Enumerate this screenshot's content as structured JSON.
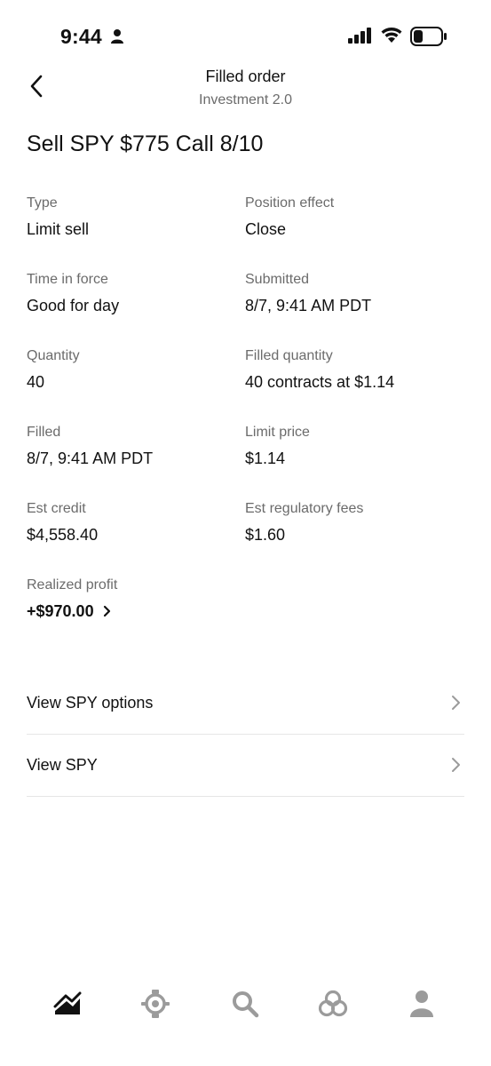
{
  "status_bar": {
    "time": "9:44"
  },
  "header": {
    "title": "Filled order",
    "subtitle": "Investment 2.0"
  },
  "order": {
    "title": "Sell SPY $775 Call 8/10"
  },
  "details": [
    {
      "label": "Type",
      "value": "Limit sell"
    },
    {
      "label": "Position effect",
      "value": "Close"
    },
    {
      "label": "Time in force",
      "value": "Good for day"
    },
    {
      "label": "Submitted",
      "value": "8/7, 9:41 AM PDT"
    },
    {
      "label": "Quantity",
      "value": "40"
    },
    {
      "label": "Filled quantity",
      "value": "40 contracts at $1.14"
    },
    {
      "label": "Filled",
      "value": "8/7, 9:41 AM PDT"
    },
    {
      "label": "Limit price",
      "value": "$1.14"
    },
    {
      "label": "Est credit",
      "value": "$4,558.40"
    },
    {
      "label": "Est regulatory fees",
      "value": "$1.60"
    }
  ],
  "realized_profit": {
    "label": "Realized profit",
    "value": "+$970.00"
  },
  "links": [
    {
      "label": "View SPY options"
    },
    {
      "label": "View SPY"
    }
  ],
  "bottom_nav": {
    "items": [
      "chart-icon",
      "options-icon",
      "search-icon",
      "network-icon",
      "account-icon"
    ],
    "active": "chart-icon",
    "active_color": "#111111",
    "inactive_color": "#9b9b9b"
  }
}
